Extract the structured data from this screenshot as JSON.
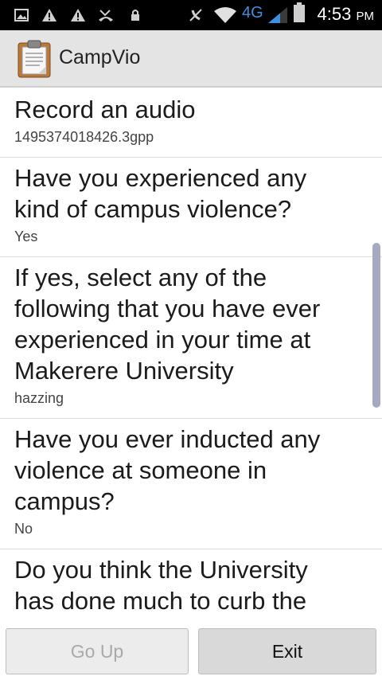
{
  "status_bar": {
    "network": "4G",
    "time": "4:53",
    "ampm": "PM",
    "icons": [
      "gallery-icon",
      "warning-icon",
      "warning-icon",
      "missed-call-icon",
      "lock-icon",
      "mute-icon",
      "wifi-icon",
      "signal-icon",
      "battery-icon"
    ]
  },
  "app": {
    "title": "CampVio",
    "icon": "clipboard-icon"
  },
  "list": {
    "items": [
      {
        "question": "Record an audio",
        "answer": "1495374018426.3gpp"
      },
      {
        "question": "Have you experienced any kind of campus violence?",
        "answer": "Yes"
      },
      {
        "question": "If yes, select any of the following that you have ever experienced in your time at Makerere University",
        "answer": "hazzing"
      },
      {
        "question": "Have you ever inducted any violence at someone in campus?",
        "answer": "No"
      },
      {
        "question": "Do you think the University has done much to curb the",
        "answer": ""
      }
    ]
  },
  "buttons": {
    "go_up": "Go Up",
    "exit": "Exit"
  },
  "colors": {
    "scrollbar": "#a7a8c2",
    "actionbar": "#e4e4e4"
  }
}
